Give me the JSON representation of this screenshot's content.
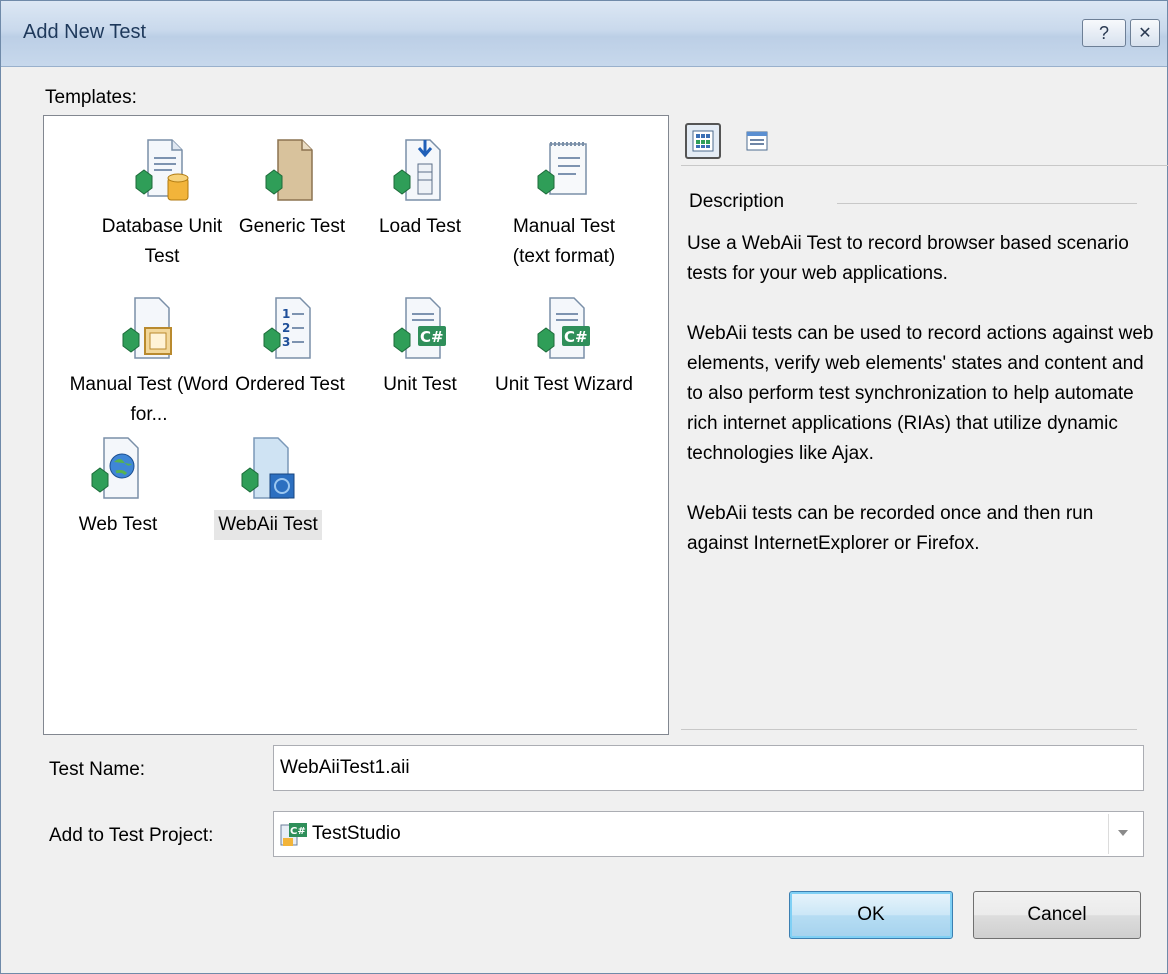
{
  "window": {
    "title": "Add New Test",
    "help_glyph": "?",
    "close_glyph": "✕"
  },
  "templates": {
    "label": "Templates:",
    "items": [
      {
        "label": "Database Unit Test",
        "icon": "database-unit-test-icon"
      },
      {
        "label": "Generic Test",
        "icon": "generic-test-icon"
      },
      {
        "label": "Load Test",
        "icon": "load-test-icon"
      },
      {
        "label": "Manual Test (text format)",
        "icon": "manual-test-text-icon"
      },
      {
        "label": "Manual Test (Word for...",
        "icon": "manual-test-word-icon"
      },
      {
        "label": "Ordered Test",
        "icon": "ordered-test-icon"
      },
      {
        "label": "Unit Test",
        "icon": "unit-test-icon"
      },
      {
        "label": "Unit Test Wizard",
        "icon": "unit-test-wizard-icon"
      },
      {
        "label": "Web Test",
        "icon": "web-test-icon"
      },
      {
        "label": "WebAii Test",
        "icon": "webaii-test-icon",
        "selected": true
      }
    ]
  },
  "description": {
    "heading": "Description",
    "paragraphs": [
      "Use a WebAii Test to record browser based scenario tests for your web applications.",
      "WebAii tests can be used to record actions against web elements, verify web elements' states and content and to also perform test synchronization to help automate rich internet applications (RIAs) that utilize dynamic technologies like Ajax.",
      "WebAii tests can be recorded once and then run against InternetExplorer or Firefox."
    ]
  },
  "form": {
    "test_name_label": "Test Name:",
    "test_name_value": "WebAiiTest1.aii",
    "project_label": "Add to Test Project:",
    "project_value": "TestStudio"
  },
  "buttons": {
    "ok": "OK",
    "cancel": "Cancel"
  },
  "colors": {
    "accent": "#3c7fb1",
    "selection": "#e6e6e6",
    "green_gem": "#2f9e58"
  }
}
